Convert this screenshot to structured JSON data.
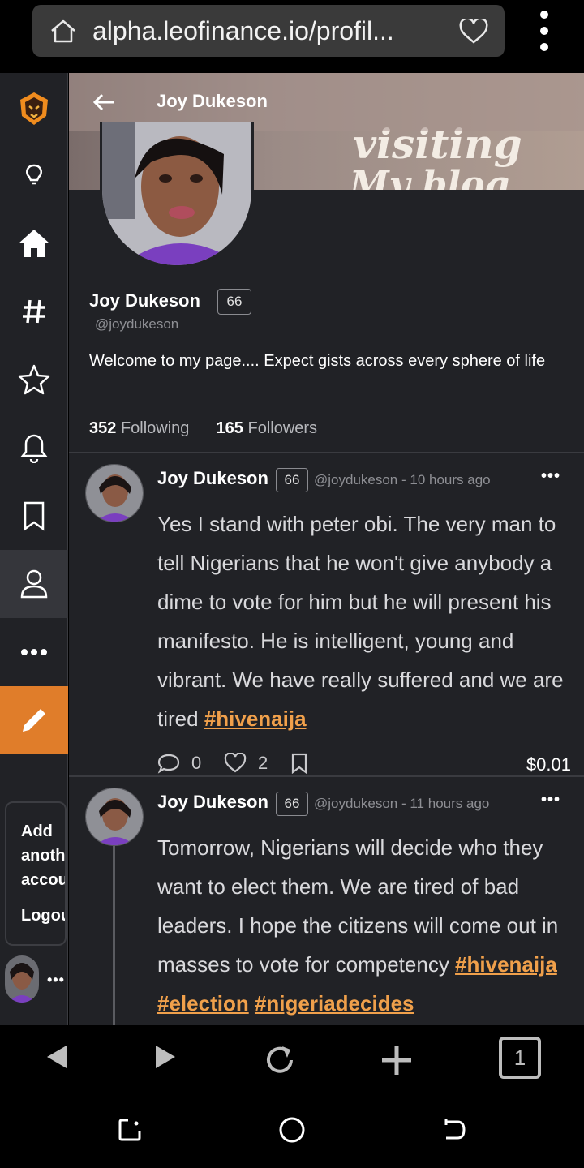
{
  "browser": {
    "url": "alpha.leofinance.io/profil...",
    "tab_count": "1"
  },
  "sidebar": {
    "items": [
      "logo-icon",
      "bulb-icon",
      "home-icon",
      "hashtag-icon",
      "star-icon",
      "bell-icon",
      "bookmark-icon",
      "user-icon",
      "more-icon",
      "pencil-icon"
    ],
    "active": "user-icon",
    "add_account_label": "Add another account",
    "logout_label": "Logout"
  },
  "header": {
    "title": "Joy Dukeson"
  },
  "profile": {
    "name": "Joy Dukeson",
    "reputation": "66",
    "handle": "@joydukeson",
    "bio": "Welcome to my page.... Expect gists across every sphere of life",
    "following_count": "352",
    "following_label": "Following",
    "followers_count": "165",
    "followers_label": "Followers"
  },
  "posts": [
    {
      "author": "Joy Dukeson",
      "reputation": "66",
      "meta": "@joydukeson - 10 hours ago",
      "text": "Yes I stand with peter obi. The very man to tell Nigerians that he won't give anybody a dime to vote for him but he will present his manifesto. He is intelligent, young and vibrant. We have really suffered and we are tired ",
      "tags": [
        "#hivenaija"
      ],
      "comments": "0",
      "likes": "2",
      "payout": "$0.01"
    },
    {
      "author": "Joy Dukeson",
      "reputation": "66",
      "meta": "@joydukeson - 11 hours ago",
      "text": "Tomorrow, Nigerians will decide who they want to elect them. We are tired of bad leaders. I hope the citizens will come out in masses to vote for competency ",
      "tags": [
        "#hivenaija",
        "#election",
        "#nigeriadecides"
      ]
    }
  ],
  "colors": {
    "accent": "#e07d2a",
    "tag": "#f0a04b",
    "background": "#212226"
  }
}
